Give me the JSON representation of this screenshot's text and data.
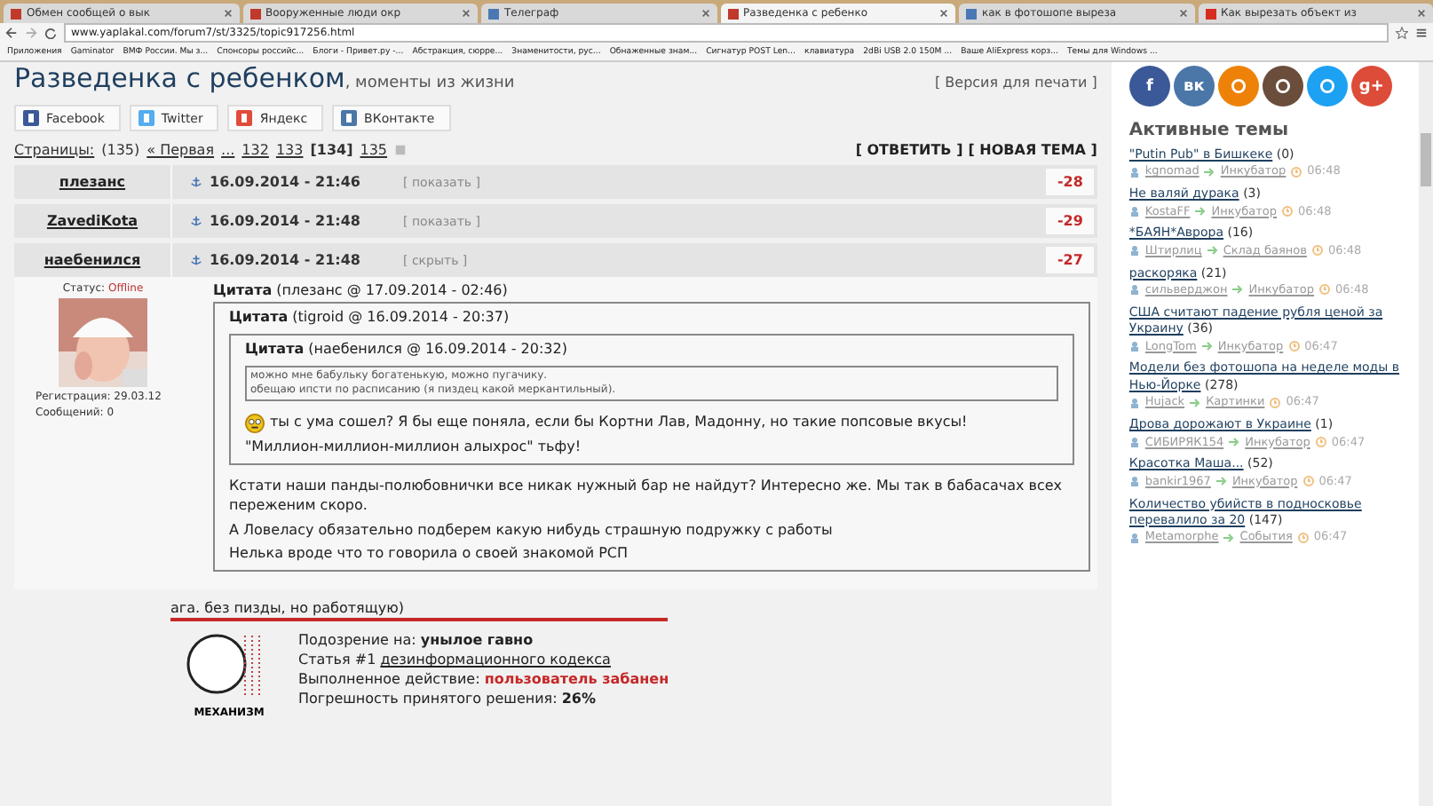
{
  "browser": {
    "tabs": [
      {
        "title": "Обмен сообщей о вык",
        "selected": false,
        "color": "#c0392b"
      },
      {
        "title": "Вооруженные люди окр",
        "selected": false,
        "color": "#c0392b"
      },
      {
        "title": "Телеграф",
        "selected": false,
        "color": "#4a78b5"
      },
      {
        "title": "Разведенка с ребенко",
        "selected": true,
        "color": "#c0392b"
      },
      {
        "title": "как в фотошопе выреза",
        "selected": false,
        "color": "#4a78b5"
      },
      {
        "title": "Как вырезать объект из",
        "selected": false,
        "color": "#d62d20"
      }
    ],
    "url": "www.yaplakal.com/forum7/st/3325/topic917256.html",
    "bookmarks": [
      "Приложения",
      "Gaminator",
      "ВМФ России. Мы з...",
      "Спонсоры российс...",
      "Блоги - Привет.ру -...",
      "Абстракция, сюрре...",
      "Знаменитости, рус...",
      "Обнаженные знам...",
      "Сигнатур POST Len...",
      "клавиатура",
      "2dBi USB 2.0 150M ...",
      "Ваше AliExpress корз...",
      "Темы для Windows ..."
    ]
  },
  "topic": {
    "title": "Разведенка с ребенком",
    "subtitle": ", моменты из жизни",
    "print_link": "[ Версия для печати ]"
  },
  "share": [
    {
      "label": "Facebook",
      "color": "#3b5998"
    },
    {
      "label": "Twitter",
      "color": "#55acee"
    },
    {
      "label": "Яндекс",
      "color": "#e04b3a"
    },
    {
      "label": "ВКонтакте",
      "color": "#4a76a8"
    }
  ],
  "pages": {
    "label": "Страницы:",
    "count": "(135)",
    "items": [
      {
        "text": "« Первая",
        "selected": false
      },
      {
        "text": "...",
        "selected": false
      },
      {
        "text": "132",
        "selected": false
      },
      {
        "text": "133",
        "selected": false
      },
      {
        "text": "[134]",
        "selected": true
      },
      {
        "text": "135",
        "selected": false
      }
    ]
  },
  "actions": [
    "[ ОТВЕТИТЬ ]",
    "[ НОВАЯ ТЕМА ]"
  ],
  "posts": [
    {
      "author": "плезанс",
      "date": "16.09.2014 - 21:46",
      "toggle": "[ показать ]",
      "score": "-28"
    },
    {
      "author": "ZavediKota",
      "date": "16.09.2014 - 21:48",
      "toggle": "[ показать ]",
      "score": "-29"
    },
    {
      "author": "наебенился",
      "date": "16.09.2014 - 21:48",
      "toggle": "[ скрыть ]",
      "score": "-27"
    }
  ],
  "post": {
    "status_label": "Статус:",
    "status": "Offline",
    "registration": "Регистрация: 29.03.12",
    "messages": "Сообщений: 0",
    "quote": {
      "header": "**Цитата** (плезанс @ 17.09.2014 - 02:46)",
      "quote": {
        "header": "**Цитата** (tigroid @ 16.09.2014 - 20:37)",
        "quote": {
          "header": "**Цитата** (наебенился @ 16.09.2014 - 20:32)",
          "lines": [
            {
              "text": "можно мне бабульку богатенькую, можно пугачику.",
              "smiley": false
            },
            {
              "text": "обещаю ипсти по расписанию (я пиздец какой меркантильный).",
              "smiley": false
            }
          ]
        },
        "lines": [
          {
            "text": "ты с ума сошел? Я бы еще поняла, если бы Кортни Лав, Мадонну, но такие попсовые вкусы!",
            "smiley": true
          },
          {
            "text": "\"Миллион-миллион-миллион алыхрос\" тьфу!",
            "smiley": false
          }
        ]
      },
      "lines": [
        {
          "text": "Кстати наши панды-полюбовнички все никак нужный бар не найдут? Интересно же. Мы так в бабасачах всех переженим скоро.",
          "smiley": false
        },
        {
          "text": "А Ловеласу обязательно подберем какую нибудь страшную подружку с работы",
          "smiley": false
        },
        {
          "text": "Нелька вроде что то говорила о своей знакомой РСП",
          "smiley": false
        }
      ]
    },
    "reply": "ага. без пизды, но работящую)",
    "ban": {
      "caption": "МЕХАНИЗМ",
      "lines": [
        {
          "label": "Подозрение на: ",
          "value": "унылое гавно",
          "kind": "bold"
        },
        {
          "label": "Статья #1 ",
          "value": "дезинформационного кодекса",
          "kind": "link"
        },
        {
          "label": "Выполненное действие: ",
          "value": "пользователь забанен",
          "kind": "alert"
        },
        {
          "label": "Погрешность принятого решения: ",
          "value": "26%",
          "kind": "bold"
        }
      ]
    }
  },
  "sidebar": {
    "socials": [
      {
        "color": "#3b5998",
        "glyph": "f"
      },
      {
        "color": "#4a76a8",
        "glyph": "вк"
      },
      {
        "color": "#ee8208"
      },
      {
        "color": "#6a4d3b"
      },
      {
        "color": "#1da1f2"
      },
      {
        "color": "#dd4b39",
        "glyph": "g+"
      }
    ],
    "title": "Активные темы",
    "topics": [
      {
        "title": "\"Putin Pub\" в Бишкеке",
        "count": "(0)",
        "user": "kgnomad",
        "section": "Инкубатор",
        "time": "06:48"
      },
      {
        "title": "Не валяй дурака",
        "count": "(3)",
        "user": "KostaFF",
        "section": "Инкубатор",
        "time": "06:48"
      },
      {
        "title": "*БАЯН*Аврора",
        "count": "(16)",
        "user": "Штирлиц",
        "section": "Склад баянов",
        "time": "06:48"
      },
      {
        "title": "раскоряка",
        "count": "(21)",
        "user": "сильверджон",
        "section": "Инкубатор",
        "time": "06:48"
      },
      {
        "title": "США считают падение рубля ценой за Украину",
        "count": "(36)",
        "user": "LongTom",
        "section": "Инкубатор",
        "time": "06:47"
      },
      {
        "title": "Модели без фотошопа на неделе моды в Нью-Йорке",
        "count": "(278)",
        "user": "Hujack",
        "section": "Картинки",
        "time": "06:47"
      },
      {
        "title": "Дрова дорожают в Украине",
        "count": "(1)",
        "user": "СИБИРЯК154",
        "section": "Инкубатор",
        "time": "06:47"
      },
      {
        "title": "Красотка Маша...",
        "count": "(52)",
        "user": "bankir1967",
        "section": "Инкубатор",
        "time": "06:47"
      },
      {
        "title": "Количество убийств в подносковье перевалило за 20",
        "count": "(147)",
        "user": "Metamorphe",
        "section": "События",
        "time": "06:47"
      }
    ]
  }
}
